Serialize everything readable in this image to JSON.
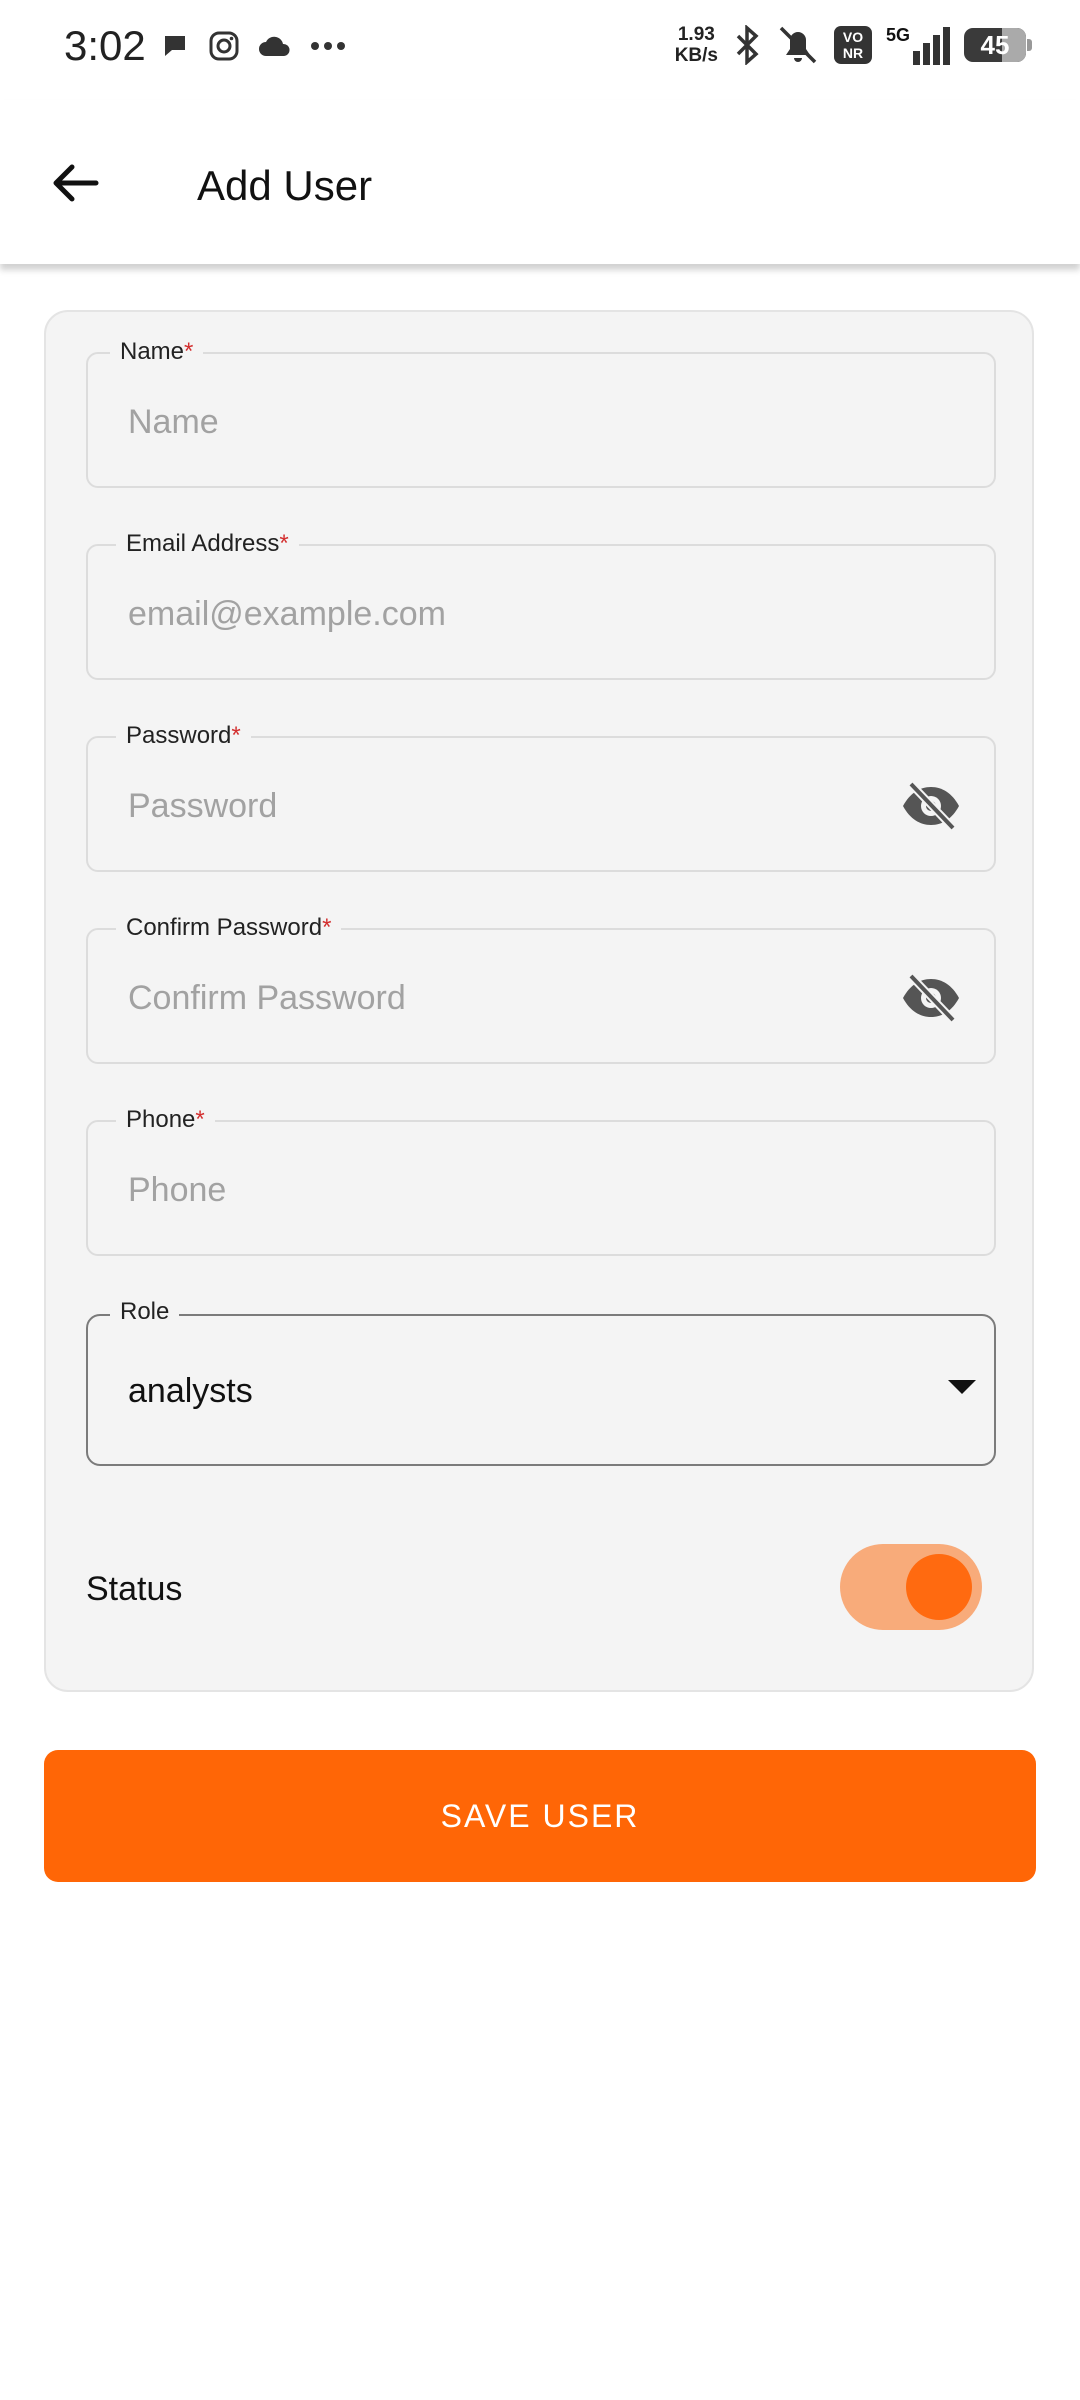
{
  "status_bar": {
    "time": "3:02",
    "net_speed_value": "1.93",
    "net_speed_unit": "KB/s",
    "volte": "VO NR",
    "network": "5G",
    "battery": "45"
  },
  "app_bar": {
    "title": "Add User"
  },
  "form": {
    "name": {
      "label": "Name",
      "placeholder": "Name",
      "required": "*"
    },
    "email": {
      "label": "Email Address",
      "placeholder": "email@example.com",
      "required": "*"
    },
    "password": {
      "label": "Password",
      "placeholder": "Password",
      "required": "*"
    },
    "confirm_password": {
      "label": "Confirm Password",
      "placeholder": "Confirm Password",
      "required": "*"
    },
    "phone": {
      "label": "Phone",
      "placeholder": "Phone",
      "required": "*"
    },
    "role": {
      "label": "Role",
      "value": "analysts"
    },
    "status": {
      "label": "Status",
      "enabled": true
    }
  },
  "save_button": {
    "label": "SAVE USER"
  },
  "colors": {
    "accent": "#ff6606",
    "toggle_track": "#f8ab7a",
    "card_bg": "#f4f4f4"
  }
}
